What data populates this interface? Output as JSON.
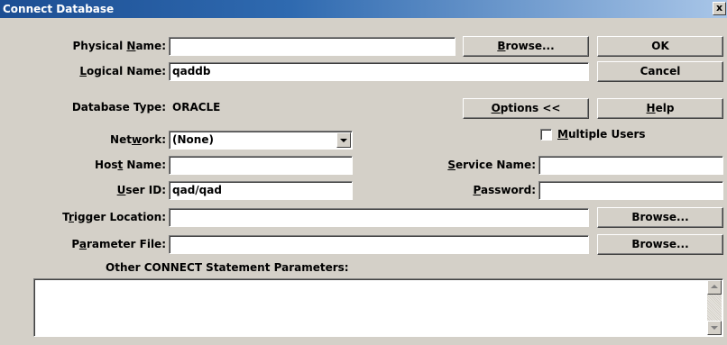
{
  "window": {
    "title": "Connect Database",
    "close_glyph": "x"
  },
  "fields": {
    "physical_name": {
      "label_pre": "Physical ",
      "label_key": "N",
      "label_post": "ame:",
      "value": ""
    },
    "logical_name": {
      "label_pre": "",
      "label_key": "L",
      "label_post": "ogical Name:",
      "value": "qaddb"
    },
    "database_type": {
      "label": "Database Type:",
      "value": "ORACLE"
    },
    "network": {
      "label_pre": "Net",
      "label_key": "w",
      "label_post": "ork:",
      "value": "(None)"
    },
    "host_name": {
      "label_pre": "Hos",
      "label_key": "t",
      "label_post": " Name:",
      "value": ""
    },
    "service_name": {
      "label_pre": "",
      "label_key": "S",
      "label_post": "ervice Name:",
      "value": ""
    },
    "user_id": {
      "label_pre": "",
      "label_key": "U",
      "label_post": "ser ID:",
      "value": "qad/qad"
    },
    "password": {
      "label_pre": "",
      "label_key": "P",
      "label_post": "assword:",
      "value": ""
    },
    "trigger_location": {
      "label_pre": "T",
      "label_key": "r",
      "label_post": "igger Location:",
      "value": ""
    },
    "parameter_file": {
      "label_pre": "P",
      "label_key": "a",
      "label_post": "rameter File:",
      "value": ""
    },
    "other_params": {
      "label": "Other CONNECT Statement Parameters:",
      "value": ""
    }
  },
  "buttons": {
    "browse_physical": {
      "pre": "",
      "key": "B",
      "post": "rowse..."
    },
    "ok": {
      "label": "OK"
    },
    "cancel": {
      "label": "Cancel"
    },
    "options": {
      "pre": "",
      "key": "O",
      "post": "ptions <<"
    },
    "help": {
      "pre": "",
      "key": "H",
      "post": "elp"
    },
    "browse_trigger": {
      "label": "Browse..."
    },
    "browse_parameter": {
      "label": "Browse..."
    }
  },
  "checkbox": {
    "label_pre": "",
    "label_key": "M",
    "label_post": "ultiple Users",
    "checked": false
  },
  "icons": [
    "close-icon",
    "chevron-down-icon",
    "scroll-up-icon",
    "scroll-down-icon"
  ],
  "colors": {
    "face": "#d4d0c8",
    "title_start": "#1c4e93",
    "title_end": "#a9c6e8"
  }
}
